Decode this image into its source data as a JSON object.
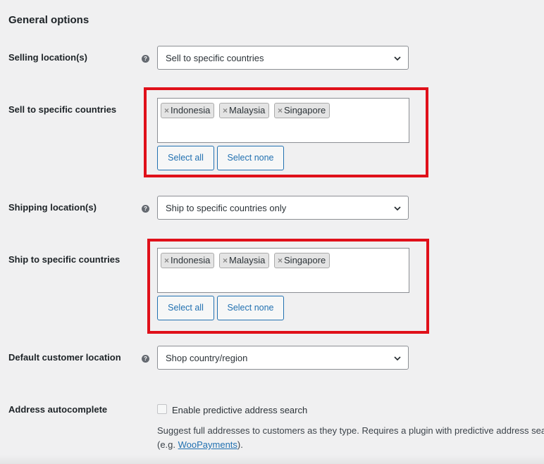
{
  "section_title": "General options",
  "selling": {
    "label": "Selling location(s)",
    "help": "?",
    "value": "Sell to specific countries"
  },
  "sell_specific": {
    "label": "Sell to specific countries",
    "countries": [
      "Indonesia",
      "Malaysia",
      "Singapore"
    ],
    "remove_glyph": "×",
    "select_all": "Select all",
    "select_none": "Select none"
  },
  "shipping": {
    "label": "Shipping location(s)",
    "help": "?",
    "value": "Ship to specific countries only"
  },
  "ship_specific": {
    "label": "Ship to specific countries",
    "countries": [
      "Indonesia",
      "Malaysia",
      "Singapore"
    ],
    "remove_glyph": "×",
    "select_all": "Select all",
    "select_none": "Select none"
  },
  "default_location": {
    "label": "Default customer location",
    "help": "?",
    "value": "Shop country/region"
  },
  "autocomplete": {
    "label": "Address autocomplete",
    "checkbox_label": "Enable predictive address search",
    "checked": false,
    "description_line1": "Suggest full addresses to customers as they type. Requires a plugin with predictive address sea",
    "description_prefix": "(e.g. ",
    "link_text": "WooPayments",
    "description_suffix": ")."
  },
  "colors": {
    "highlight": "#e0101a",
    "link": "#2271b1",
    "background": "#f0f0f1"
  },
  "icons": {
    "help": "help-icon",
    "dropdown": "chevron-down-icon",
    "remove": "remove-icon"
  }
}
